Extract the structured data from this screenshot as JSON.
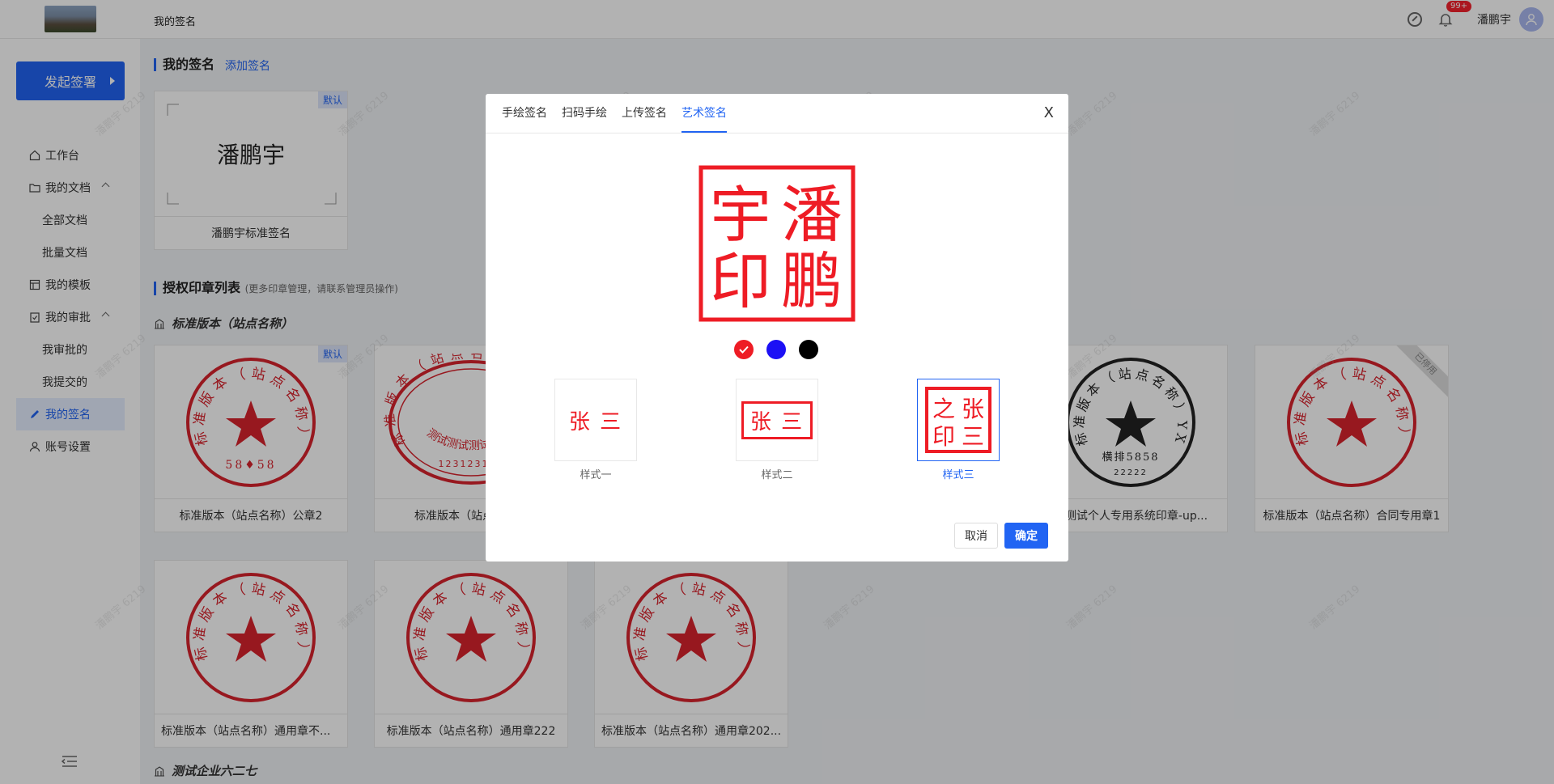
{
  "topbar": {
    "page_name": "我的签名",
    "badge": "99+",
    "user_name": "潘鹏宇"
  },
  "sidebar": {
    "start_button": "发起签署",
    "items": [
      {
        "label": "工作台",
        "icon": "home-icon"
      },
      {
        "label": "我的文档",
        "icon": "folder-icon"
      },
      {
        "label": "全部文档"
      },
      {
        "label": "批量文档"
      },
      {
        "label": "我的模板",
        "icon": "template-icon"
      },
      {
        "label": "我的审批",
        "icon": "approval-icon"
      },
      {
        "label": "我审批的"
      },
      {
        "label": "我提交的"
      },
      {
        "label": "我的签名",
        "icon": "pen-icon"
      },
      {
        "label": "账号设置",
        "icon": "user-icon"
      }
    ]
  },
  "main": {
    "my_signature_title": "我的签名",
    "add_signature": "添加签名",
    "signature_card": {
      "text": "潘鹏宇",
      "tag": "默认",
      "label": "潘鹏宇标准签名"
    },
    "seal_list_title": "授权印章列表",
    "seal_list_note": "(更多印章管理，请联系管理员操作)",
    "group1": "标准版本（站点名称）",
    "group2": "测试企业六二七",
    "seals_row1": [
      {
        "label": "标准版本（站点名称）公章2",
        "tag": "默认",
        "center_text": "58♦58"
      },
      {
        "label": "标准版本（站点名称）"
      },
      {
        "label": ""
      },
      {
        "label": "云测试个人专用系统印章-up..."
      },
      {
        "label": "标准版本（站点名称）合同专用章1",
        "corner": "已停用"
      }
    ],
    "seals_row2": [
      {
        "label": "标准版本（站点名称）通用章不..."
      },
      {
        "label": "标准版本（站点名称）通用章222"
      },
      {
        "label": "标准版本（站点名称）通用章202..."
      }
    ],
    "seal_ring_text": "标准版本（站点名称）",
    "oval_seal_text": "测试测试测试",
    "oval_seal_number": "123123123",
    "black_seal_text": "横排5858",
    "black_seal_ring": "标准版本（站点名称）YX",
    "black_seal_number": "22222"
  },
  "watermark": "潘鹏宇 6219",
  "modal": {
    "tabs": [
      "手绘签名",
      "扫码手绘",
      "上传签名",
      "艺术签名"
    ],
    "active_tab": 3,
    "close": "X",
    "preview_chars": [
      "宇",
      "潘",
      "印",
      "鹏"
    ],
    "colors": [
      "#ee1c25",
      "#1c10f5",
      "#000000"
    ],
    "selected_color": 0,
    "styles": [
      {
        "label": "样式一",
        "text": "张 三"
      },
      {
        "label": "样式二",
        "text": "张 三"
      },
      {
        "label": "样式三",
        "chars": [
          "之",
          "张",
          "印",
          "三"
        ]
      }
    ],
    "selected_style": 2,
    "cancel": "取消",
    "ok": "确定"
  }
}
